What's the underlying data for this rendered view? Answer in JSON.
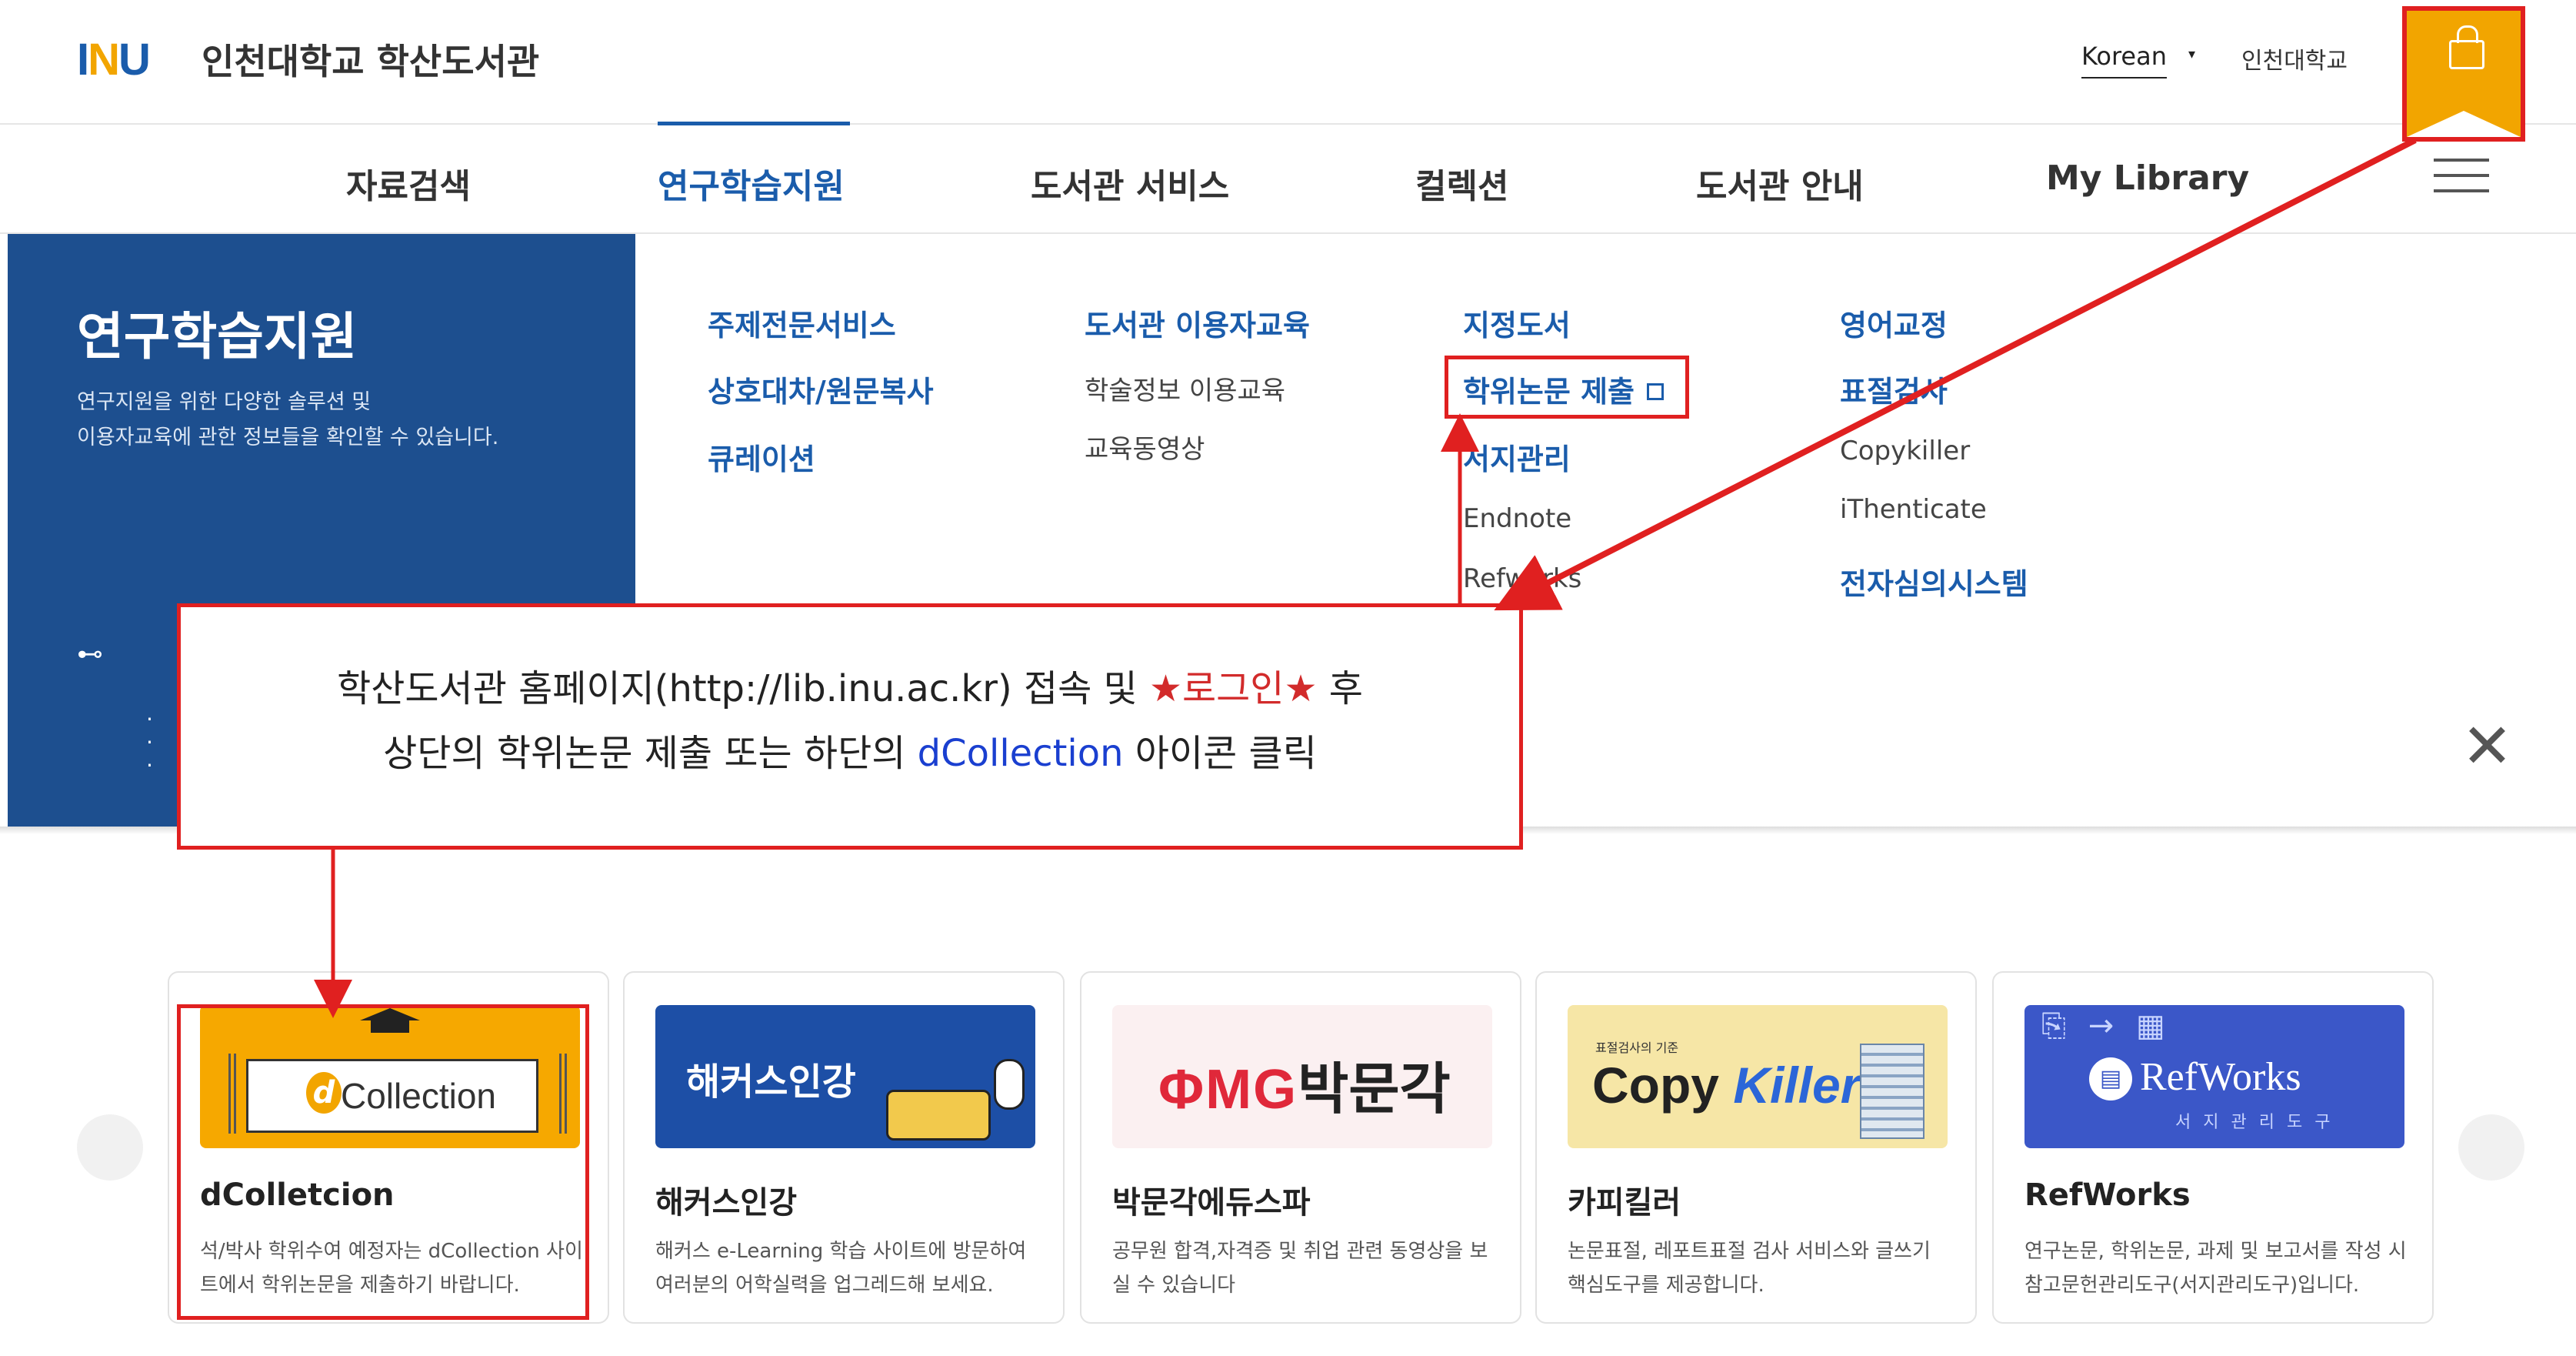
{
  "header": {
    "logo_mark_1": "I",
    "logo_mark_n": "N",
    "logo_mark_u": "U",
    "logo_text": "인천대학교 학산도서관",
    "language": "Korean",
    "univ_link": "인천대학교"
  },
  "gnb": {
    "items": [
      {
        "label": "자료검색"
      },
      {
        "label": "연구학습지원",
        "active": true
      },
      {
        "label": "도서관 서비스"
      },
      {
        "label": "컬렉션"
      },
      {
        "label": "도서관 안내"
      },
      {
        "label": "My Library"
      }
    ]
  },
  "mega": {
    "title": "연구학습지원",
    "desc": "연구지원을 위한 다양한 솔루션 및\n이용자교육에 관한 정보들을 확인할 수 있습니다.",
    "columns": [
      {
        "items": [
          {
            "label": "주제전문서비스",
            "kind": "main"
          },
          {
            "label": "상호대차/원문복사",
            "kind": "main"
          },
          {
            "label": "큐레이션",
            "kind": "main"
          }
        ]
      },
      {
        "items": [
          {
            "label": "도서관 이용자교육",
            "kind": "main"
          },
          {
            "label": "학술정보 이용교육",
            "kind": "sub"
          },
          {
            "label": "교육동영상",
            "kind": "sub"
          }
        ]
      },
      {
        "items": [
          {
            "label": "지정도서",
            "kind": "main"
          },
          {
            "label": "학위논문 제출",
            "kind": "main",
            "external": true
          },
          {
            "label": "서지관리",
            "kind": "main"
          },
          {
            "label": "Endnote",
            "kind": "sub"
          },
          {
            "label": "Refworks",
            "kind": "sub"
          }
        ]
      },
      {
        "items": [
          {
            "label": "영어교정",
            "kind": "main"
          },
          {
            "label": "표절검사",
            "kind": "main"
          },
          {
            "label": "Copykiller",
            "kind": "sub"
          },
          {
            "label": "iThenticate",
            "kind": "sub"
          },
          {
            "label": "전자심의시스템",
            "kind": "main"
          }
        ]
      }
    ]
  },
  "callout": {
    "line1_a": "학산도서관 홈페이지(http://lib.inu.ac.kr) 접속 및 ",
    "line1_highlight": "★로그인★",
    "line1_b": " 후",
    "line2_a": "상단의 학위논문 제출 또는 하단의 ",
    "line2_highlight": "dCollection",
    "line2_b": " 아이콘 클릭"
  },
  "cards": [
    {
      "title": "dColletcion",
      "desc": "석/박사 학위수여 예정자는 dCollection 사이트에서 학위논문을 제출하기 바랍니다.",
      "thumb_text": "Collection",
      "thumb_d": "d"
    },
    {
      "title": "해커스인강",
      "desc": "해커스 e-Learning 학습 사이트에 방문하여 여러분의 어학실력을 업그레드해 보세요.",
      "thumb_text": "해커스인강"
    },
    {
      "title": "박문각에듀스파",
      "desc": "공무원 합격,자격증 및 취업 관련 동영상을 보실 수 있습니다",
      "thumb_text": "박문각",
      "thumb_pmg": "ΦMG"
    },
    {
      "title": "카피킬러",
      "desc": "논문표절, 레포트표절 검사 서비스와 글쓰기 핵심도구를 제공합니다.",
      "thumb_small": "표절검사의 기준",
      "thumb_copy": "Copy ",
      "thumb_killer": "Killer"
    },
    {
      "title": "RefWorks",
      "desc": "연구논문, 학위논문, 과제 및 보고서를 작성 시 참고문헌관리도구(서지관리도구)입니다.",
      "thumb_text": "RefWorks",
      "thumb_sub": "서지관리도구"
    }
  ],
  "colors": {
    "brand_blue": "#1a5cab",
    "accent_orange": "#f2a500",
    "annotation_red": "#e02020",
    "mega_bg": "#1d4f8f"
  },
  "icons": [
    "lock-icon",
    "hamburger-icon",
    "external-link-icon",
    "close-icon",
    "chevron-left-icon",
    "chevron-right-icon"
  ]
}
